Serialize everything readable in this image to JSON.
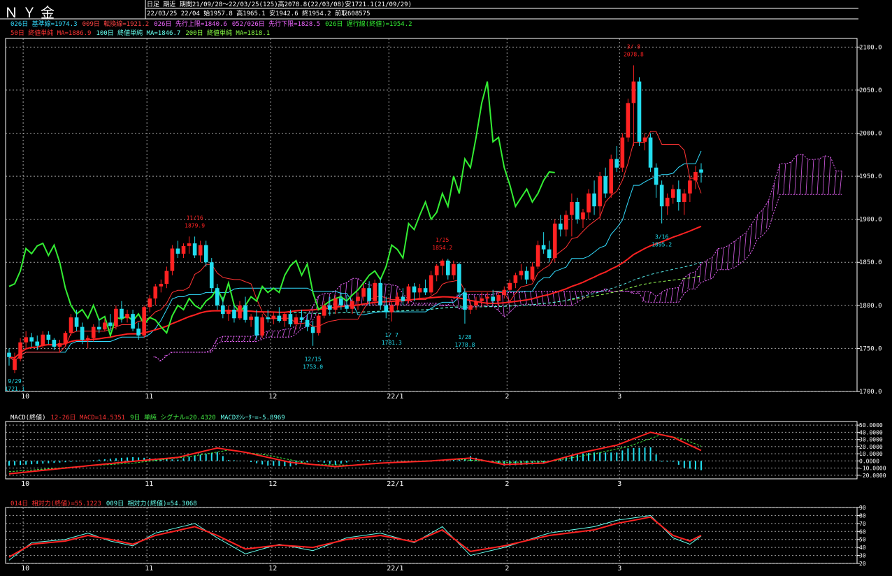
{
  "header": {
    "instrument": "ＮＹ金",
    "period_line": "日足 期近 期間21/09/28～22/03/25(125)高2078.8(22/03/08)安1721.1(21/09/29)",
    "quote_line": "22/03/25 22/04 始1957.8 高1965.1 安1942.6 終1954.2 前取608575",
    "legend_row1": [
      {
        "text": "026日 基準線=1974.3",
        "color": "#33ddff"
      },
      {
        "text": "009日 転換線=1921.2",
        "color": "#ff4444"
      },
      {
        "text": "026日 先行上限=1840.6",
        "color": "#ee66ff"
      },
      {
        "text": "052/026日 先行下限=1828.5",
        "color": "#ee66ff"
      },
      {
        "text": "026日 遅行線(終値)=1954.2",
        "color": "#33ee33"
      }
    ],
    "legend_row2": [
      {
        "text": "50日 終値単純 MA=1886.9",
        "color": "#ff3333"
      },
      {
        "text": "100日 終値単純 MA=1846.7",
        "color": "#66ffee"
      },
      {
        "text": "200日 終値単純 MA=1818.1",
        "color": "#88ff44"
      }
    ],
    "macd_legend": [
      {
        "text": "MACD(終値)",
        "color": "#ffffff"
      },
      {
        "text": "12-26日 MACD=14.5351",
        "color": "#ff3333"
      },
      {
        "text": "9日 単純 シグナル=20.4320",
        "color": "#44ee44"
      },
      {
        "text": "MACDｵｼﾚｰﾀｰ=-5.8969",
        "color": "#66ffee"
      }
    ],
    "rsi_legend": [
      {
        "text": "014日 相対力(終値)=55.1223",
        "color": "#ff3333"
      },
      {
        "text": "009日 相対力(終値)=54.3068",
        "color": "#66ffee"
      }
    ]
  },
  "chart_data": [
    {
      "type": "candlestick",
      "panel": "price",
      "ylim": [
        1700,
        2110
      ],
      "yticks": [
        1700,
        1750,
        1800,
        1850,
        1900,
        1950,
        2000,
        2050,
        2100
      ],
      "ytick_labels": [
        "1700.0",
        "1750.0",
        "1800.0",
        "1850.0",
        "1900.0",
        "1950.0",
        "2000.0",
        "2050.0",
        "2100.0"
      ],
      "xtick_labels": [
        "10",
        "11",
        "12",
        "22/1",
        "2",
        "3"
      ],
      "xtick_index": [
        2,
        24,
        46,
        67,
        88,
        108
      ],
      "candles_ohlc": [
        [
          1745,
          1750,
          1730,
          1740
        ],
        [
          1725,
          1745,
          1721.1,
          1738
        ],
        [
          1738,
          1762,
          1735,
          1757
        ],
        [
          1757,
          1770,
          1750,
          1763
        ],
        [
          1763,
          1768,
          1752,
          1758
        ],
        [
          1758,
          1765,
          1748,
          1753
        ],
        [
          1753,
          1770,
          1750,
          1766
        ],
        [
          1766,
          1770,
          1755,
          1760
        ],
        [
          1760,
          1762,
          1748,
          1752
        ],
        [
          1752,
          1760,
          1745,
          1756
        ],
        [
          1756,
          1770,
          1753,
          1768
        ],
        [
          1768,
          1790,
          1765,
          1786
        ],
        [
          1786,
          1795,
          1770,
          1775
        ],
        [
          1775,
          1780,
          1755,
          1760
        ],
        [
          1760,
          1765,
          1750,
          1762
        ],
        [
          1762,
          1778,
          1758,
          1775
        ],
        [
          1775,
          1785,
          1768,
          1772
        ],
        [
          1772,
          1784,
          1770,
          1780
        ],
        [
          1780,
          1790,
          1770,
          1776
        ],
        [
          1776,
          1800,
          1772,
          1796
        ],
        [
          1796,
          1805,
          1780,
          1785
        ],
        [
          1785,
          1795,
          1780,
          1790
        ],
        [
          1790,
          1795,
          1770,
          1773
        ],
        [
          1773,
          1780,
          1760,
          1765
        ],
        [
          1765,
          1800,
          1762,
          1798
        ],
        [
          1798,
          1812,
          1792,
          1808
        ],
        [
          1808,
          1825,
          1800,
          1822
        ],
        [
          1822,
          1830,
          1815,
          1825
        ],
        [
          1825,
          1845,
          1820,
          1840
        ],
        [
          1840,
          1870,
          1835,
          1866
        ],
        [
          1866,
          1875,
          1855,
          1860
        ],
        [
          1860,
          1872,
          1855,
          1869
        ],
        [
          1869,
          1880,
          1860,
          1872
        ],
        [
          1872,
          1879.9,
          1855,
          1858
        ],
        [
          1858,
          1875,
          1850,
          1870
        ],
        [
          1870,
          1875,
          1845,
          1850
        ],
        [
          1850,
          1855,
          1815,
          1820
        ],
        [
          1820,
          1825,
          1795,
          1800
        ],
        [
          1800,
          1810,
          1785,
          1790
        ],
        [
          1790,
          1800,
          1782,
          1795
        ],
        [
          1795,
          1800,
          1780,
          1785
        ],
        [
          1785,
          1805,
          1783,
          1800
        ],
        [
          1800,
          1810,
          1780,
          1783
        ],
        [
          1783,
          1790,
          1775,
          1787
        ],
        [
          1787,
          1795,
          1760,
          1765
        ],
        [
          1765,
          1790,
          1762,
          1786
        ],
        [
          1786,
          1795,
          1780,
          1784
        ],
        [
          1784,
          1792,
          1778,
          1788
        ],
        [
          1788,
          1798,
          1780,
          1782
        ],
        [
          1782,
          1792,
          1775,
          1790
        ],
        [
          1790,
          1795,
          1775,
          1778
        ],
        [
          1778,
          1790,
          1772,
          1786
        ],
        [
          1786,
          1795,
          1780,
          1783
        ],
        [
          1783,
          1790,
          1770,
          1775
        ],
        [
          1775,
          1782,
          1753,
          1768
        ],
        [
          1768,
          1790,
          1765,
          1788
        ],
        [
          1788,
          1805,
          1785,
          1800
        ],
        [
          1800,
          1810,
          1788,
          1795
        ],
        [
          1795,
          1812,
          1790,
          1808
        ],
        [
          1808,
          1815,
          1795,
          1800
        ],
        [
          1800,
          1812,
          1792,
          1796
        ],
        [
          1796,
          1808,
          1790,
          1805
        ],
        [
          1805,
          1815,
          1795,
          1810
        ],
        [
          1810,
          1825,
          1805,
          1820
        ],
        [
          1820,
          1828,
          1800,
          1805
        ],
        [
          1805,
          1830,
          1800,
          1826
        ],
        [
          1826,
          1832,
          1795,
          1800
        ],
        [
          1800,
          1810,
          1785,
          1792
        ],
        [
          1792,
          1805,
          1781.3,
          1800
        ],
        [
          1800,
          1815,
          1795,
          1810
        ],
        [
          1810,
          1820,
          1800,
          1805
        ],
        [
          1805,
          1825,
          1802,
          1822
        ],
        [
          1822,
          1826,
          1805,
          1815
        ],
        [
          1815,
          1825,
          1808,
          1820
        ],
        [
          1820,
          1830,
          1812,
          1815
        ],
        [
          1815,
          1840,
          1812,
          1835
        ],
        [
          1835,
          1848,
          1828,
          1846
        ],
        [
          1846,
          1854.2,
          1835,
          1852
        ],
        [
          1852,
          1854,
          1830,
          1835
        ],
        [
          1835,
          1852,
          1830,
          1848
        ],
        [
          1848,
          1850,
          1810,
          1815
        ],
        [
          1815,
          1820,
          1778.8,
          1795
        ],
        [
          1795,
          1805,
          1790,
          1800
        ],
        [
          1800,
          1810,
          1795,
          1805
        ],
        [
          1805,
          1815,
          1798,
          1808
        ],
        [
          1808,
          1815,
          1800,
          1810
        ],
        [
          1810,
          1818,
          1802,
          1805
        ],
        [
          1805,
          1815,
          1800,
          1812
        ],
        [
          1812,
          1822,
          1808,
          1818
        ],
        [
          1818,
          1830,
          1815,
          1826
        ],
        [
          1826,
          1838,
          1820,
          1835
        ],
        [
          1835,
          1848,
          1830,
          1840
        ],
        [
          1840,
          1845,
          1825,
          1830
        ],
        [
          1830,
          1850,
          1828,
          1845
        ],
        [
          1845,
          1875,
          1842,
          1870
        ],
        [
          1870,
          1885,
          1860,
          1865
        ],
        [
          1865,
          1875,
          1850,
          1855
        ],
        [
          1855,
          1900,
          1850,
          1895
        ],
        [
          1895,
          1905,
          1880,
          1888
        ],
        [
          1888,
          1910,
          1880,
          1905
        ],
        [
          1905,
          1930,
          1880,
          1920
        ],
        [
          1920,
          1925,
          1895,
          1900
        ],
        [
          1900,
          1912,
          1890,
          1908
        ],
        [
          1908,
          1935,
          1900,
          1930
        ],
        [
          1930,
          1945,
          1905,
          1915
        ],
        [
          1915,
          1955,
          1900,
          1950
        ],
        [
          1950,
          1960,
          1925,
          1930
        ],
        [
          1930,
          1975,
          1925,
          1970
        ],
        [
          1970,
          1985,
          1955,
          1960
        ],
        [
          1960,
          2000,
          1955,
          1995
        ],
        [
          1995,
          2040,
          1990,
          2035
        ],
        [
          2035,
          2078.8,
          1985,
          2060
        ],
        [
          2060,
          2065,
          1985,
          1990
        ],
        [
          1990,
          2000,
          1980,
          1995
        ],
        [
          1995,
          2000,
          1955,
          1960
        ],
        [
          1960,
          1965,
          1925,
          1940
        ],
        [
          1940,
          1945,
          1895.2,
          1915
        ],
        [
          1915,
          1930,
          1905,
          1925
        ],
        [
          1925,
          1940,
          1918,
          1935
        ],
        [
          1935,
          1945,
          1910,
          1920
        ],
        [
          1920,
          1935,
          1905,
          1930
        ],
        [
          1930,
          1950,
          1920,
          1945
        ],
        [
          1945,
          1962,
          1935,
          1955
        ],
        [
          1957.8,
          1965.1,
          1942.6,
          1954.2
        ]
      ],
      "annotations": [
        {
          "i": 1,
          "label": "9/29",
          "value": "1721.1",
          "pos": "below"
        },
        {
          "i": 33,
          "label": "11/16",
          "value": "1879.9",
          "pos": "above"
        },
        {
          "i": 54,
          "label": "12/15",
          "value": "1753.0",
          "pos": "below"
        },
        {
          "i": 68,
          "label": "1/ 7",
          "value": "1781.3",
          "pos": "below"
        },
        {
          "i": 77,
          "label": "1/25",
          "value": "1854.2",
          "pos": "above"
        },
        {
          "i": 81,
          "label": "1/28",
          "value": "1778.8",
          "pos": "below"
        },
        {
          "i": 111,
          "label": "3/ 8",
          "value": "2078.8",
          "pos": "above"
        },
        {
          "i": 116,
          "label": "3/16",
          "value": "1895.2",
          "pos": "below"
        }
      ]
    },
    {
      "type": "bar+line",
      "panel": "macd",
      "ylim": [
        -25,
        55
      ],
      "ytick_labels": [
        "50.0000",
        "40.0000",
        "30.0000",
        "20.0000",
        "10.0000",
        "0.0000",
        "-10.0000",
        "-20.0000"
      ],
      "yticks": [
        50,
        40,
        30,
        20,
        10,
        0,
        -10,
        -20
      ],
      "xtick_labels": [
        "10",
        "11",
        "12",
        "22/1",
        "2",
        "3"
      ],
      "macd_knots": [
        [
          0,
          -18
        ],
        [
          10,
          -10
        ],
        [
          20,
          -2
        ],
        [
          30,
          5
        ],
        [
          37,
          18
        ],
        [
          42,
          12
        ],
        [
          50,
          -2
        ],
        [
          58,
          -8
        ],
        [
          66,
          -3
        ],
        [
          75,
          0
        ],
        [
          82,
          4
        ],
        [
          88,
          -5
        ],
        [
          95,
          -3
        ],
        [
          102,
          12
        ],
        [
          108,
          22
        ],
        [
          114,
          40
        ],
        [
          118,
          33
        ],
        [
          123,
          14.5351
        ]
      ],
      "signal_knots": [
        [
          0,
          -15
        ],
        [
          12,
          -8
        ],
        [
          22,
          -3
        ],
        [
          32,
          6
        ],
        [
          39,
          15
        ],
        [
          46,
          8
        ],
        [
          54,
          -5
        ],
        [
          62,
          -6
        ],
        [
          70,
          -1
        ],
        [
          80,
          2
        ],
        [
          88,
          -2
        ],
        [
          96,
          -1
        ],
        [
          104,
          10
        ],
        [
          110,
          20
        ],
        [
          116,
          37
        ],
        [
          120,
          30
        ],
        [
          123,
          20.432
        ]
      ]
    },
    {
      "type": "line",
      "panel": "rsi",
      "ylim": [
        20,
        90
      ],
      "yticks": [
        20,
        30,
        40,
        50,
        60,
        70,
        80,
        90
      ],
      "ytick_labels": [
        "20",
        "30",
        "40",
        "50",
        "60",
        "70",
        "80",
        "90"
      ],
      "xtick_labels": [
        "10",
        "11",
        "12",
        "22/1",
        "2",
        "3"
      ],
      "rsi14_knots": [
        [
          0,
          28
        ],
        [
          4,
          44
        ],
        [
          10,
          48
        ],
        [
          14,
          55
        ],
        [
          18,
          50
        ],
        [
          22,
          44
        ],
        [
          26,
          55
        ],
        [
          33,
          66
        ],
        [
          37,
          55
        ],
        [
          42,
          38
        ],
        [
          48,
          43
        ],
        [
          54,
          40
        ],
        [
          60,
          50
        ],
        [
          66,
          55
        ],
        [
          72,
          47
        ],
        [
          77,
          62
        ],
        [
          82,
          35
        ],
        [
          88,
          42
        ],
        [
          96,
          55
        ],
        [
          104,
          62
        ],
        [
          108,
          70
        ],
        [
          114,
          78
        ],
        [
          118,
          55
        ],
        [
          121,
          48
        ],
        [
          123,
          55.1223
        ]
      ],
      "rsi9_knots": [
        [
          0,
          24
        ],
        [
          4,
          46
        ],
        [
          10,
          50
        ],
        [
          14,
          58
        ],
        [
          18,
          48
        ],
        [
          22,
          42
        ],
        [
          26,
          58
        ],
        [
          33,
          70
        ],
        [
          37,
          52
        ],
        [
          42,
          32
        ],
        [
          48,
          44
        ],
        [
          54,
          36
        ],
        [
          60,
          52
        ],
        [
          66,
          58
        ],
        [
          72,
          46
        ],
        [
          77,
          66
        ],
        [
          82,
          30
        ],
        [
          88,
          40
        ],
        [
          96,
          58
        ],
        [
          104,
          66
        ],
        [
          108,
          74
        ],
        [
          114,
          80
        ],
        [
          118,
          52
        ],
        [
          121,
          44
        ],
        [
          123,
          54.3068
        ]
      ]
    }
  ],
  "colors": {
    "up": "#ff2222",
    "down": "#22ddee",
    "grid": "#cccccc",
    "sma50": "#ff2222",
    "sma100": "#55eeee",
    "sma200": "#99ff55",
    "kijun": "#33ddff",
    "tenkan": "#ff3333",
    "chikou": "#33ee33",
    "cloud": "#ee66ff"
  }
}
